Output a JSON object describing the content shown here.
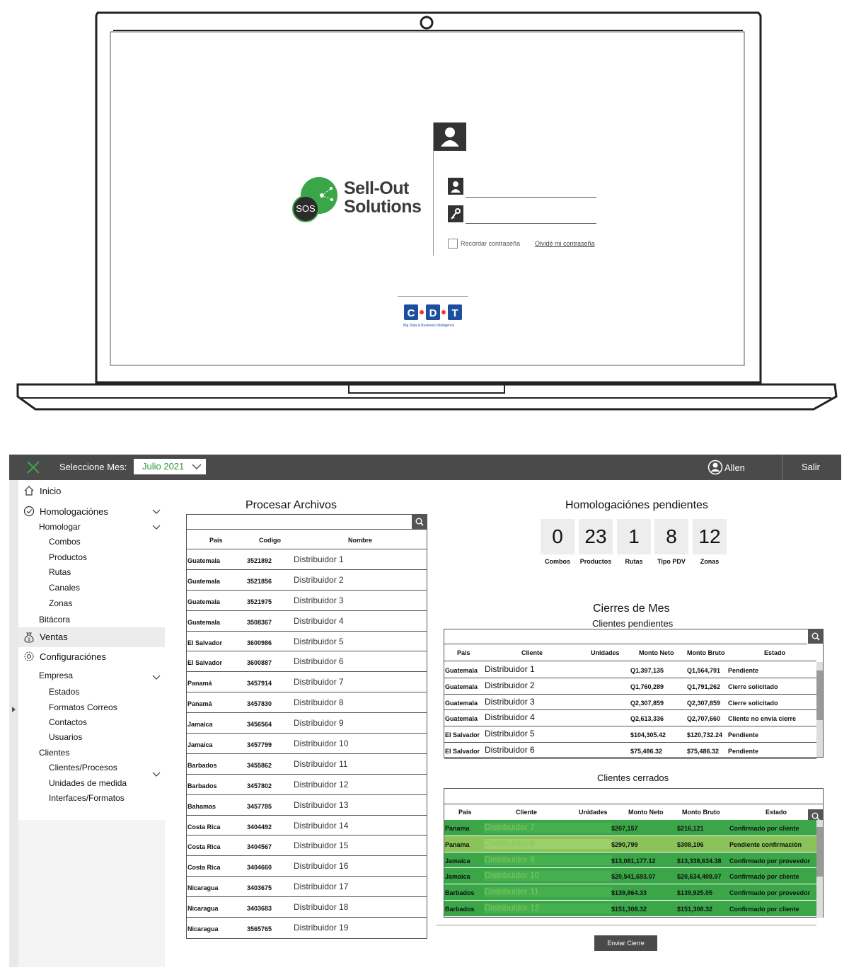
{
  "login": {
    "brand_line1": "Sell-Out",
    "brand_line2": "Solutions",
    "brand_badge": "SOS",
    "remember_label": "Recordar contraseña",
    "forgot_link": "Olvidé mi contraseña",
    "partner_logo": "C·D·T",
    "partner_tagline": "Big Data & Business Intelligence"
  },
  "colors": {
    "brand_green": "#3aa648",
    "topbar": "#4a4a4a",
    "row_green": "#3aa648",
    "row_light_green": "#8bc35a"
  },
  "topbar": {
    "month_label": "Seleccione Mes:",
    "month_value": "Julio 2021",
    "user_name": "Allen",
    "logout": "Salir"
  },
  "sidebar": {
    "inicio": "Inicio",
    "homologaciones": "Homologaciónes",
    "homologar": "Homologar",
    "combos": "Combos",
    "productos": "Productos",
    "rutas": "Rutas",
    "canales": "Canales",
    "zonas": "Zonas",
    "bitacora": "Bitácora",
    "ventas": "Ventas",
    "configuraciones": "Configuraciónes",
    "empresa": "Empresa",
    "estados": "Estados",
    "formatos_correos": "Formatos Correos",
    "contactos": "Contactos",
    "usuarios": "Usuarios",
    "clientes": "Clientes",
    "clientes_procesos": "Clientes/Procesos",
    "unidades_medida": "Unidades de medida",
    "interfaces_formatos": "Interfaces/Formatos"
  },
  "procesar": {
    "title": "Procesar Archivos",
    "headers": [
      "País",
      "Codigo",
      "Nombre"
    ],
    "rows": [
      [
        "Guatemala",
        "3521892",
        "Distribuidor 1"
      ],
      [
        "Guatemala",
        "3521856",
        "Distribuidor 2"
      ],
      [
        "Guatemala",
        "3521975",
        "Distribuidor 3"
      ],
      [
        "Guatemala",
        "3508367",
        "Distribuidor 4"
      ],
      [
        "El Salvador",
        "3600986",
        "Distribuidor 5"
      ],
      [
        "El Salvador",
        "3600887",
        "Distribuidor 6"
      ],
      [
        "Panamá",
        "3457914",
        "Distribuidor 7"
      ],
      [
        "Panamá",
        "3457830",
        "Distribuidor 8"
      ],
      [
        "Jamaica",
        "3456564",
        "Distribuidor 9"
      ],
      [
        "Jamaica",
        "3457799",
        "Distribuidor 10"
      ],
      [
        "Barbados",
        "3455862",
        "Distribuidor 11"
      ],
      [
        "Barbados",
        "3457802",
        "Distribuidor 12"
      ],
      [
        "Bahamas",
        "3457785",
        "Distribuidor 13"
      ],
      [
        "Costa Rica",
        "3404492",
        "Distribuidor 14"
      ],
      [
        "Costa Rica",
        "3404567",
        "Distribuidor 15"
      ],
      [
        "Costa Rica",
        "3404660",
        "Distribuidor 16"
      ],
      [
        "Nicaragua",
        "3403675",
        "Distribuidor 17"
      ],
      [
        "Nicaragua",
        "3403683",
        "Distribuidor 18"
      ],
      [
        "Nicaragua",
        "3565765",
        "Distribuidor 19"
      ]
    ]
  },
  "pendientes": {
    "title": "Homologaciónes pendientes",
    "counters": [
      {
        "value": "0",
        "label": "Combos"
      },
      {
        "value": "23",
        "label": "Productos"
      },
      {
        "value": "1",
        "label": "Rutas"
      },
      {
        "value": "8",
        "label": "Tipo PDV"
      },
      {
        "value": "12",
        "label": "Zonas"
      }
    ]
  },
  "cierres": {
    "title": "Cierres de Mes",
    "pending_subtitle": "Clientes pendientes",
    "closed_subtitle": "Clientes cerrados",
    "headers": [
      "Pais",
      "Cliente",
      "Unidades",
      "Monto Neto",
      "Monto Bruto",
      "Estado"
    ],
    "pending_rows": [
      [
        "Guatemala",
        "Distribuidor 1",
        "",
        "Q1,397,135",
        "Q1,564,791",
        "Pendiente"
      ],
      [
        "Guatemala",
        "Distribuidor 2",
        "",
        "Q1,760,289",
        "Q1,791,262",
        "Cierre solicitado"
      ],
      [
        "Guatemala",
        "Distribuidor 3",
        "",
        "Q2,307,859",
        "Q2,307,859",
        "Cierre solicitado"
      ],
      [
        "Guatemala",
        "Distribuidor 4",
        "",
        "Q2,613,336",
        "Q2,707,660",
        "Cliente no envía cierre"
      ],
      [
        "El Salvador",
        "Distribuidor 5",
        "",
        "$104,305.42",
        "$120,732.24",
        "Pendiente"
      ],
      [
        "El Salvador",
        "Distribuidor 6",
        "",
        "$75,486.32",
        "$75,486.32",
        "Pendiente"
      ]
    ],
    "closed_rows": [
      [
        "Panama",
        "Distribuidor 7",
        "",
        "$207,157",
        "$216,121",
        "Confirmado por cliente"
      ],
      [
        "Panama",
        "Distribuidor 8",
        "",
        "$290,799",
        "$308,106",
        "Pendiente confirmación"
      ],
      [
        "Jamaica",
        "Distribuidor 9",
        "",
        "$13,081,177.12",
        "$13,338,634.38",
        "Confirmado por proveedor"
      ],
      [
        "Jamaica",
        "Distribuidor 10",
        "",
        "$20,541,693.07",
        "$20,634,408.97",
        "Confirmado por cliente"
      ],
      [
        "Barbados",
        "Distribuidor 11",
        "",
        "$139,864.33",
        "$139,925.05",
        "Confirmado por proveedor"
      ],
      [
        "Barbados",
        "Distribuidor 12",
        "",
        "$151,308.32",
        "$151,308.32",
        "Confirmado por cliente"
      ]
    ],
    "send_button": "Enviar Cierre"
  }
}
